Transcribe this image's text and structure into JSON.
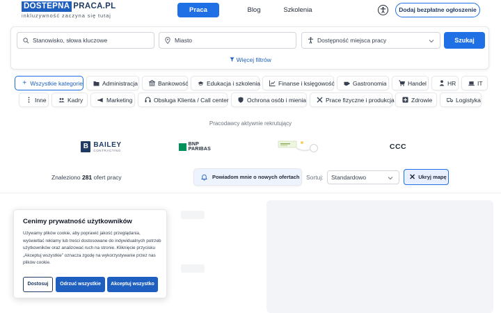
{
  "header": {
    "logo_part1": "DOSTEPNA",
    "logo_part2": "PRACA.PL",
    "tagline": "inkluzywność zaczyna się tutaj",
    "nav": [
      {
        "label": "Praca",
        "active": true
      },
      {
        "label": "Blog",
        "active": false
      },
      {
        "label": "Szkolenia",
        "active": false
      }
    ],
    "accessibility_icon": "accessibility-icon",
    "add_listing_label": "Dodaj bezpłatne ogłoszenie"
  },
  "search": {
    "keywords_placeholder": "Stanowisko, słowa kluczowe",
    "city_placeholder": "Miasto",
    "accessibility_select": "Dostępność miejsca pracy",
    "submit_label": "Szukaj",
    "more_filters_label": "Więcej filtrów"
  },
  "categories": [
    {
      "label": "Wszystkie kategorie",
      "icon": "+",
      "active": true
    },
    {
      "label": "Administracja",
      "icon": "folder-icon"
    },
    {
      "label": "Bankowość",
      "icon": "bank-icon"
    },
    {
      "label": "Edukacja i szkolenia",
      "icon": "graduation-cap-icon"
    },
    {
      "label": "Finanse i księgowość",
      "icon": "chart-icon"
    },
    {
      "label": "Gastronomia",
      "icon": "coffee-icon"
    },
    {
      "label": "Handel",
      "icon": "cart-icon"
    },
    {
      "label": "HR",
      "icon": "person-icon"
    },
    {
      "label": "IT",
      "icon": "laptop-icon"
    },
    {
      "label": "Inne",
      "icon": "dots-icon"
    },
    {
      "label": "Kadry",
      "icon": "people-icon"
    },
    {
      "label": "Marketing",
      "icon": "megaphone-icon"
    },
    {
      "label": "Obsługa Klienta / Call center",
      "icon": "headset-icon"
    },
    {
      "label": "Ochrona osób i mienia",
      "icon": "shield-icon"
    },
    {
      "label": "Prace fizyczne i produkcja",
      "icon": "tools-icon"
    },
    {
      "label": "Zdrowie",
      "icon": "medical-icon"
    },
    {
      "label": "Logistyka",
      "icon": "truck-icon"
    }
  ],
  "employers": {
    "title": "Pracodawcy aktywnie rekrutujący",
    "bailey_name": "BAILEY",
    "bailey_sub": "CONTRACTING",
    "bnp_name": "BNP PARIBAS",
    "ccc_name": "CCC"
  },
  "results": {
    "found_prefix": "Znaleziono",
    "found_count": "281",
    "found_suffix": "ofert pracy",
    "notify_label": "Powiadom mnie o nowych ofertach",
    "sort_label": "Sortuj:",
    "sort_value": "Standardowo",
    "hide_map_label": "Ukryj mapę"
  },
  "cookie": {
    "title": "Cenimy prywatność użytkowników",
    "text": "Używamy plików cookie, aby poprawić jakość przeglądania, wyświetlać reklamy lub treści dostosowane do indywidualnych potrzeb użytkowników oraz analizować ruch na stronie. Kliknięcie przycisku „Akceptuj wszystkie” oznacza zgodę na wykorzystywanie przez nas plików cookie.",
    "customize_label": "Dostosuj",
    "reject_label": "Odrzuć wszystkie",
    "accept_label": "Akceptuj wszystko"
  },
  "colors": {
    "primary": "#1f6fe5",
    "dark_blue": "#1f3a63",
    "bnp_green": "#00915a"
  }
}
